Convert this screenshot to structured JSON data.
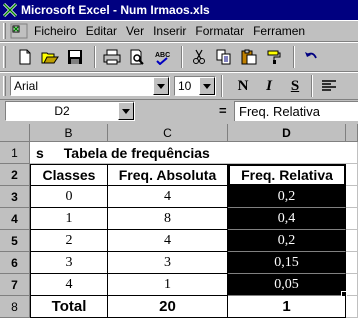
{
  "window": {
    "title": "Microsoft Excel - Num Irmaos.xls"
  },
  "menu": {
    "items": [
      "Ficheiro",
      "Editar",
      "Ver",
      "Inserir",
      "Formatar",
      "Ferramen"
    ]
  },
  "format": {
    "font": "Arial",
    "size": "10",
    "bold": "N",
    "italic": "I",
    "underline": "S"
  },
  "formula": {
    "cell_ref": "D2",
    "equals": "=",
    "content": "Freq. Relativa"
  },
  "columns": [
    "B",
    "C",
    "D"
  ],
  "rows": [
    "1",
    "2",
    "3",
    "4",
    "5",
    "6",
    "7",
    "8"
  ],
  "sheet": {
    "title": "Tabela de frequências",
    "title_prefix": "s",
    "headers": [
      "Classes",
      "Freq. Absoluta",
      "Freq. Relativa"
    ],
    "data": [
      [
        "0",
        "4",
        "0,2"
      ],
      [
        "1",
        "8",
        "0,4"
      ],
      [
        "2",
        "4",
        "0,2"
      ],
      [
        "3",
        "3",
        "0,15"
      ],
      [
        "4",
        "1",
        "0,05"
      ]
    ],
    "totals": [
      "Total",
      "20",
      "1"
    ]
  }
}
